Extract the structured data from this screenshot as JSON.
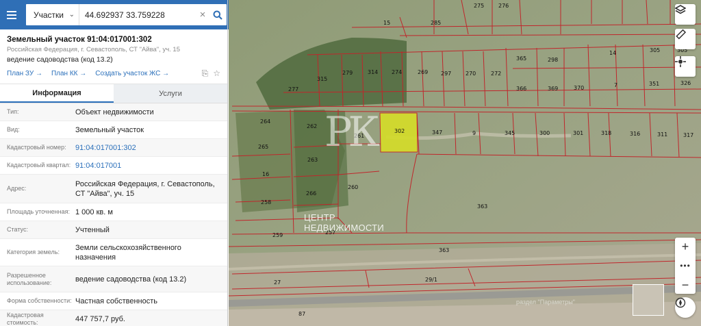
{
  "search": {
    "type_label": "Участки",
    "value": "44.692937 33.759228"
  },
  "parcel": {
    "title": "Земельный участок 91:04:017001:302",
    "address": "Российская Федерация, г. Севастополь, СТ \"Айва\", уч. 15",
    "use": "ведение садоводства (код 13.2)",
    "links": [
      "План ЗУ →",
      "План КК →",
      "Создать участок ЖС →"
    ]
  },
  "tabs": [
    {
      "label": "Информация",
      "active": true
    },
    {
      "label": "Услуги",
      "active": false
    }
  ],
  "info": [
    {
      "label": "Тип:",
      "value": "Объект недвижимости"
    },
    {
      "label": "Вид:",
      "value": "Земельный участок"
    },
    {
      "label": "Кадастровый номер:",
      "value": "91:04:017001:302",
      "link": true
    },
    {
      "label": "Кадастровый квартал:",
      "value": "91:04:017001",
      "link": true
    },
    {
      "label": "Адрес:",
      "value": "Российская Федерация, г. Севастополь, СТ \"Айва\", уч. 15"
    },
    {
      "label": "Площадь уточненная:",
      "value": "1 000 кв. м"
    },
    {
      "label": "Статус:",
      "value": "Учтенный"
    },
    {
      "label": "Категория земель:",
      "value": "Земли сельскохозяйственного назначения"
    },
    {
      "label": "Разрешенное использование:",
      "value": "ведение садоводства (код 13.2)"
    },
    {
      "label": "Форма собственности:",
      "value": "Частная собственность"
    },
    {
      "label": "Кадастровая стоимость:",
      "value": "447 757,7 руб."
    }
  ],
  "map": {
    "watermark_logo": "РК",
    "watermark_line1": "ЦЕНТР",
    "watermark_line2": "НЕДВИЖИМОСТИ",
    "attribution": "раздел \"Параметры\"",
    "highlight_color": "#d4dc2a",
    "boundary_color": "#c0262b",
    "parcel_labels": [
      "275",
      "276",
      "15",
      "285",
      "305",
      "365",
      "298",
      "14",
      "305",
      "277",
      "315",
      "279",
      "314",
      "274",
      "269",
      "297",
      "270",
      "272",
      "366",
      "369",
      "370",
      "7",
      "351",
      "326",
      "264",
      "262",
      "302",
      "347",
      "9",
      "345",
      "300",
      "301",
      "318",
      "316",
      "311",
      "317",
      "265",
      "261",
      "263",
      "16",
      "260",
      "266",
      "258",
      "363",
      "259",
      "257",
      "363",
      "27",
      "29/1",
      "87"
    ]
  },
  "controls": {
    "zoom_in": "+",
    "zoom_more": "•••",
    "zoom_out": "−"
  }
}
